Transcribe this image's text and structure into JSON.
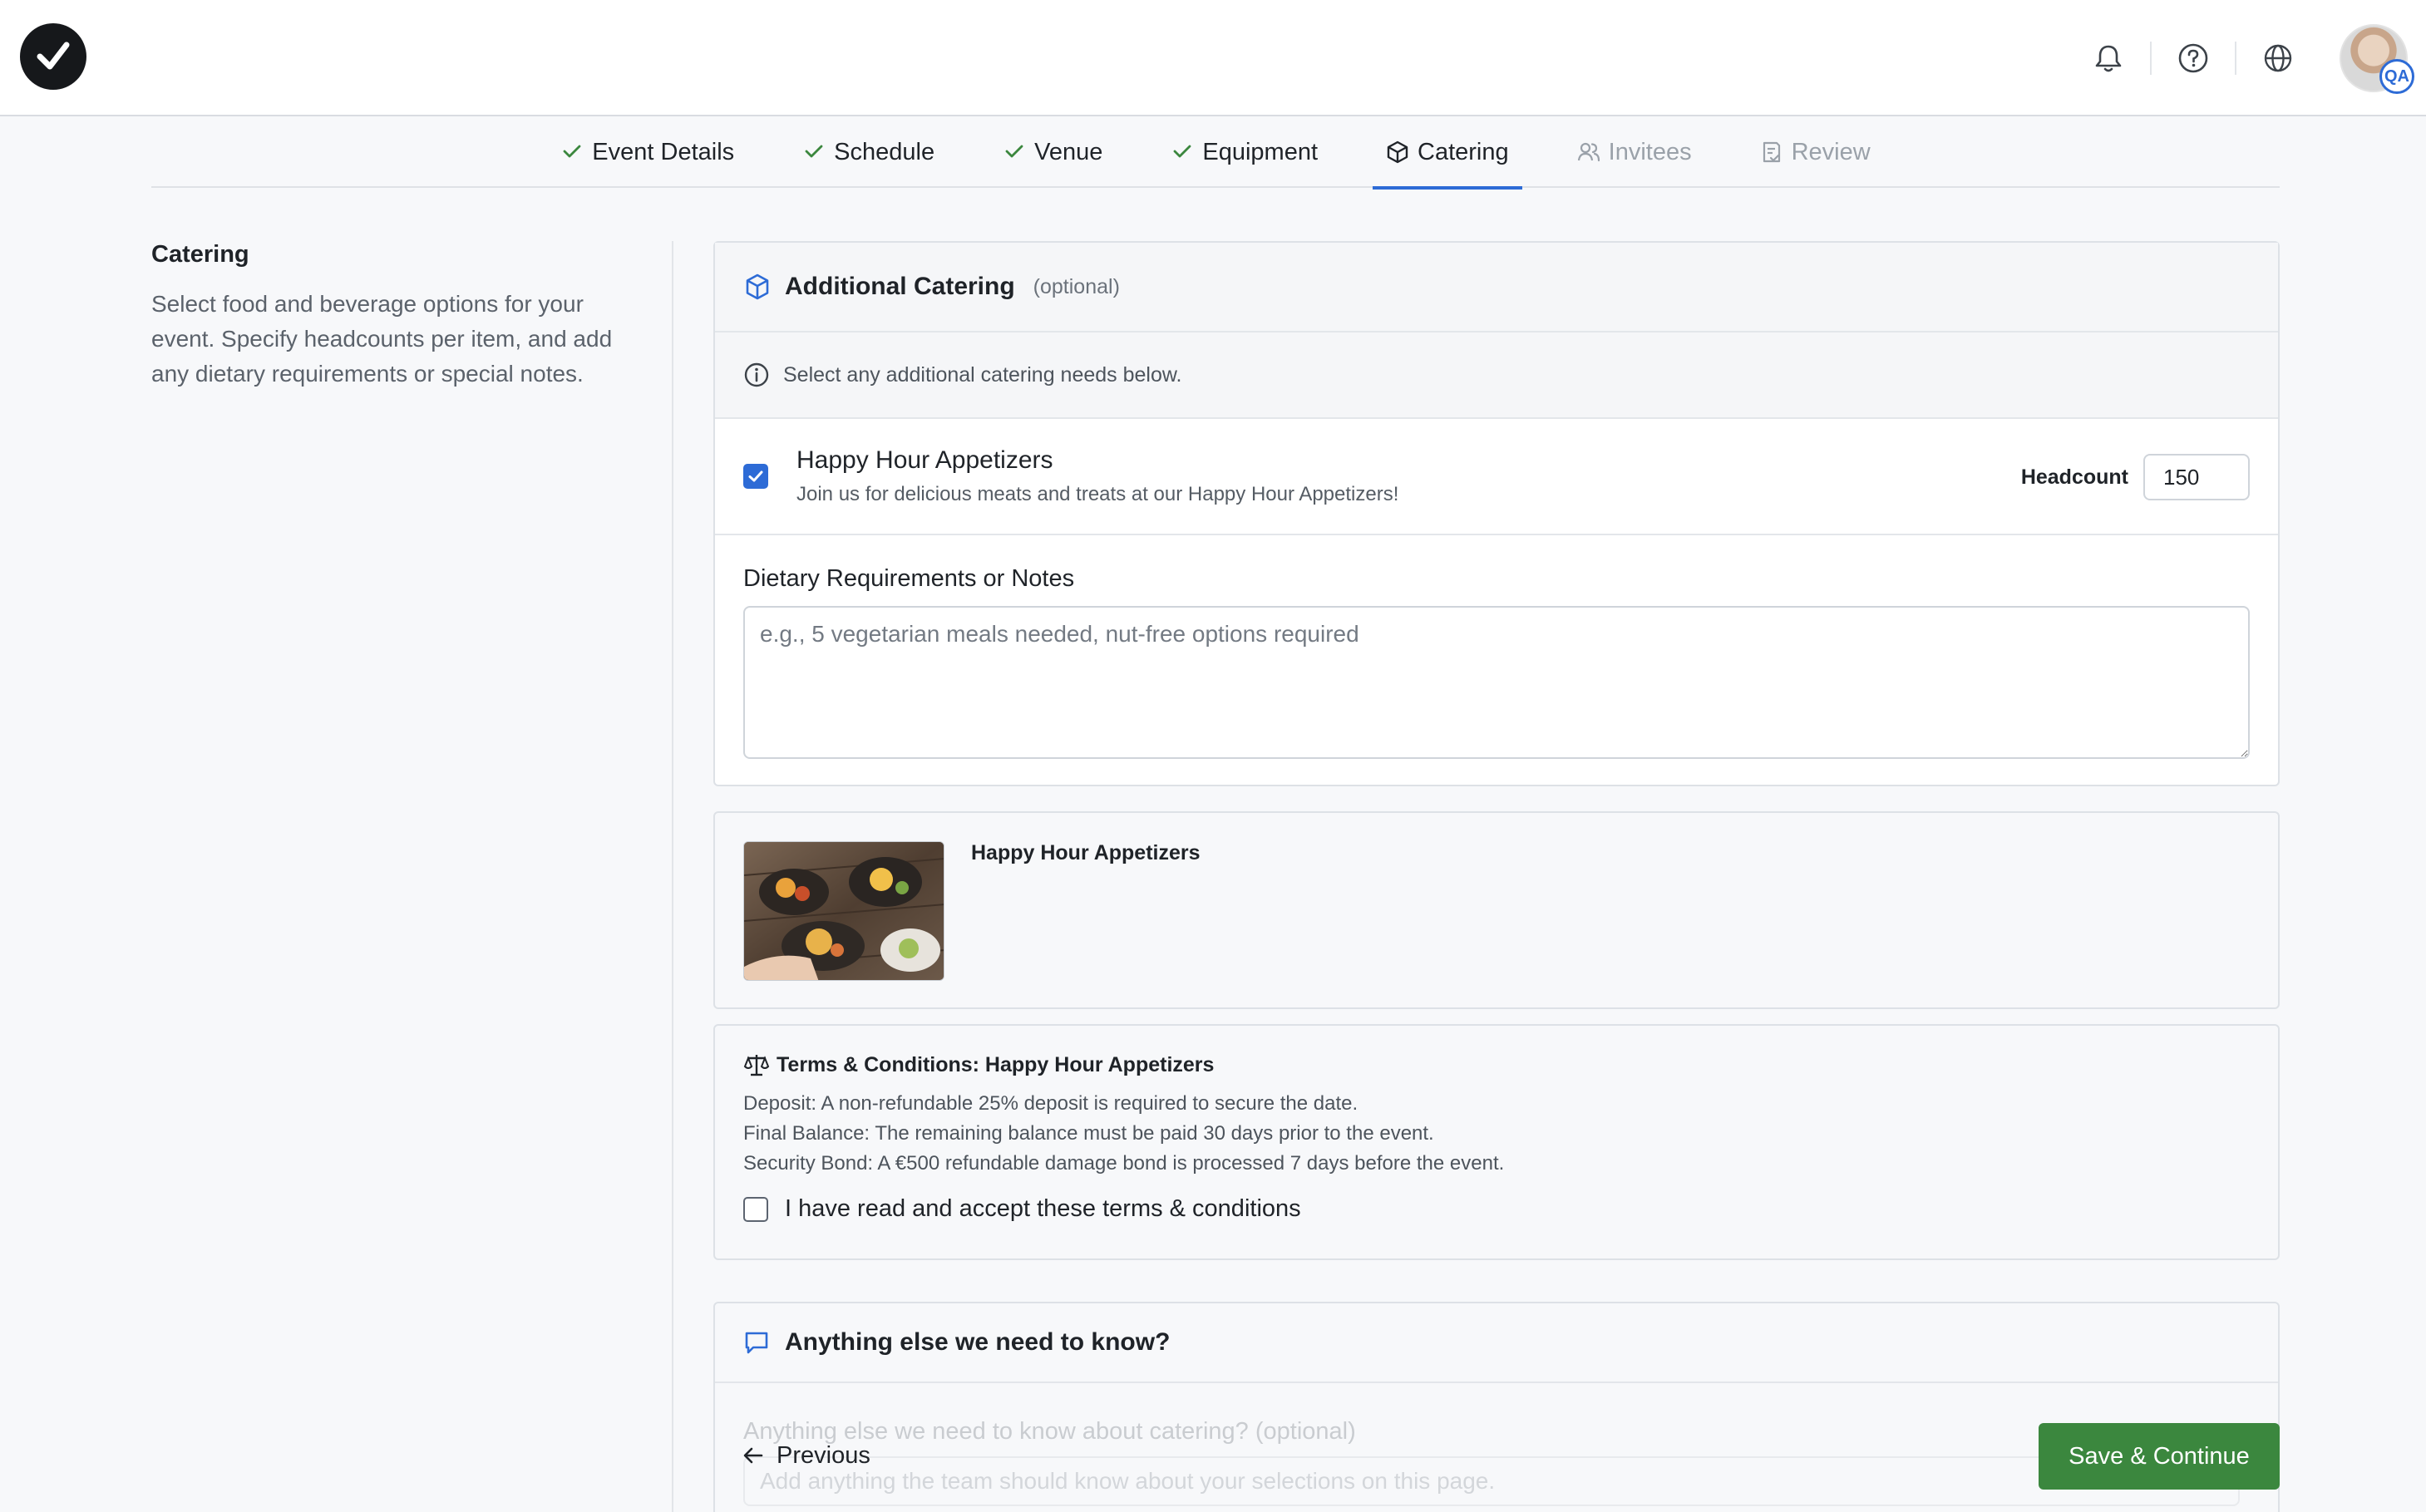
{
  "header": {
    "icons": [
      "bell-icon",
      "help-circle-icon",
      "globe-icon"
    ],
    "avatar_badge": "QA"
  },
  "stepper": {
    "steps": [
      {
        "label": "Event Details",
        "state": "complete",
        "icon": "check-icon"
      },
      {
        "label": "Schedule",
        "state": "complete",
        "icon": "check-icon"
      },
      {
        "label": "Venue",
        "state": "complete",
        "icon": "check-icon"
      },
      {
        "label": "Equipment",
        "state": "complete",
        "icon": "check-icon"
      },
      {
        "label": "Catering",
        "state": "active",
        "icon": "cube-icon"
      },
      {
        "label": "Invitees",
        "state": "disabled",
        "icon": "users-icon"
      },
      {
        "label": "Review",
        "state": "disabled",
        "icon": "document-check-icon"
      }
    ],
    "colors": {
      "active": "#2d6bd6",
      "complete_check": "#3b873e",
      "disabled": "#9aa1a9"
    }
  },
  "sidebar": {
    "title": "Catering",
    "description": "Select food and beverage options for your event. Specify headcounts per item, and add any dietary requirements or special notes."
  },
  "catering_card": {
    "title": "Additional Catering",
    "subtitle": "(optional)",
    "info": "Select any additional catering needs below.",
    "item": {
      "checked": true,
      "title": "Happy Hour Appetizers",
      "description": "Join us for delicious meats and treats at our Happy Hour Appetizers!",
      "headcount_label": "Headcount",
      "headcount_value": "150"
    },
    "notes": {
      "label": "Dietary Requirements or Notes",
      "placeholder": "e.g., 5 vegetarian meals needed, nut-free options required",
      "value": ""
    }
  },
  "preview": {
    "title": "Happy Hour Appetizers",
    "image": "food-photo"
  },
  "terms": {
    "title": "Terms & Conditions: Happy Hour Appetizers",
    "lines": [
      "Deposit: A non-refundable 25% deposit is required to secure the date.",
      "Final Balance: The remaining balance must be paid 30 days prior to the event.",
      "Security Bond: A €500 refundable damage bond is processed 7 days before the event."
    ],
    "accept_label": "I have read and accept these terms & conditions",
    "accepted": false
  },
  "extra": {
    "title": "Anything else we need to know?",
    "field_label": "Anything else we need to know about catering? (optional)",
    "field_placeholder": "Add anything the team should know about your selections on this page."
  },
  "footer": {
    "previous_label": "Previous",
    "save_label": "Save & Continue",
    "save_color": "#3b873e"
  }
}
